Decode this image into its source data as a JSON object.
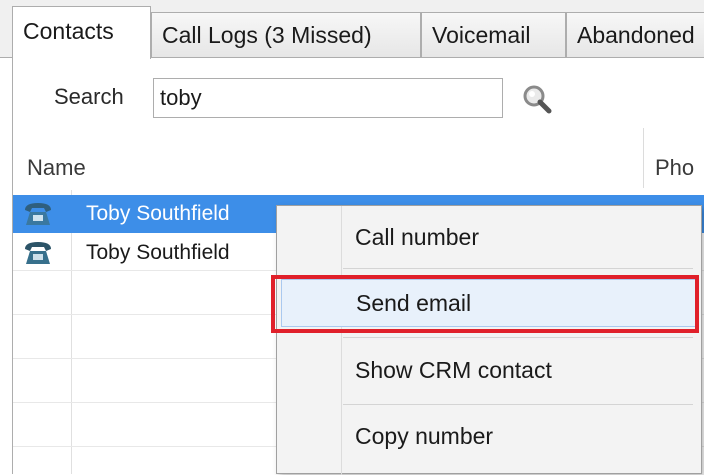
{
  "tabs": [
    {
      "label": "Contacts",
      "active": true
    },
    {
      "label": "Call Logs (3 Missed)",
      "active": false
    },
    {
      "label": "Voicemail",
      "active": false
    },
    {
      "label": "Abandoned",
      "active": false
    }
  ],
  "search": {
    "label": "Search",
    "value": "toby"
  },
  "columns": {
    "name": "Name",
    "phone": "Pho"
  },
  "contacts": [
    {
      "name": "Toby Southfield",
      "selected": true,
      "icon": "telephone-icon"
    },
    {
      "name": "Toby Southfield",
      "selected": false,
      "icon": "telephone-icon"
    }
  ],
  "context_menu": {
    "items": [
      {
        "label": "Call number"
      },
      {
        "label": "Send email",
        "highlighted": true
      },
      {
        "label": "Show CRM contact"
      },
      {
        "label": "Copy number"
      }
    ]
  },
  "colors": {
    "selection": "#3d8ee8",
    "highlight_border": "#e0202a",
    "menu_hover": "#e8f1fb"
  }
}
